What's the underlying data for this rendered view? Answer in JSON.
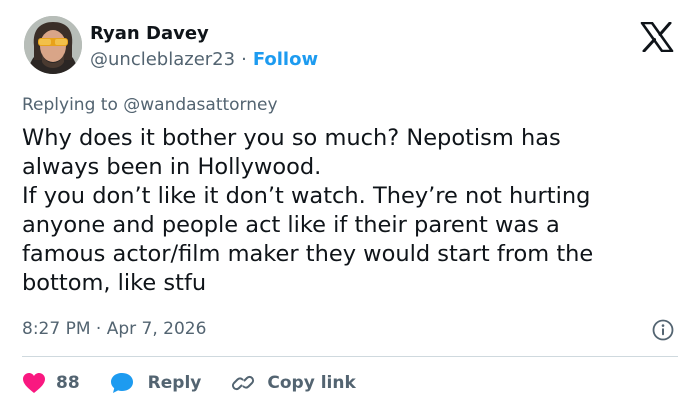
{
  "author": {
    "name": "Ryan Davey",
    "handle": "@uncleblazer23",
    "separator": "·",
    "follow_label": "Follow"
  },
  "logo_icon": "x-logo-icon",
  "reply_context": {
    "prefix": "Replying to",
    "handle": "@wandasattorney"
  },
  "tweet": {
    "lines": [
      "Why does it bother you so much? Nepotism has",
      "always been in Hollywood.",
      "If you don’t like it don’t watch. They’re not hurting",
      "anyone and people act like if their parent was a",
      "famous actor/film maker they would start from the",
      "bottom, like stfu"
    ],
    "timestamp": "8:27 PM · Apr 7, 2026"
  },
  "actions": {
    "likes_count": "88",
    "reply_label": "Reply",
    "copy_link_label": "Copy link"
  },
  "colors": {
    "like": "#f91880",
    "reply": "#1d9bf0",
    "follow": "#1d9bf0",
    "secondary_text": "#536471",
    "primary_text": "#0f1419"
  }
}
